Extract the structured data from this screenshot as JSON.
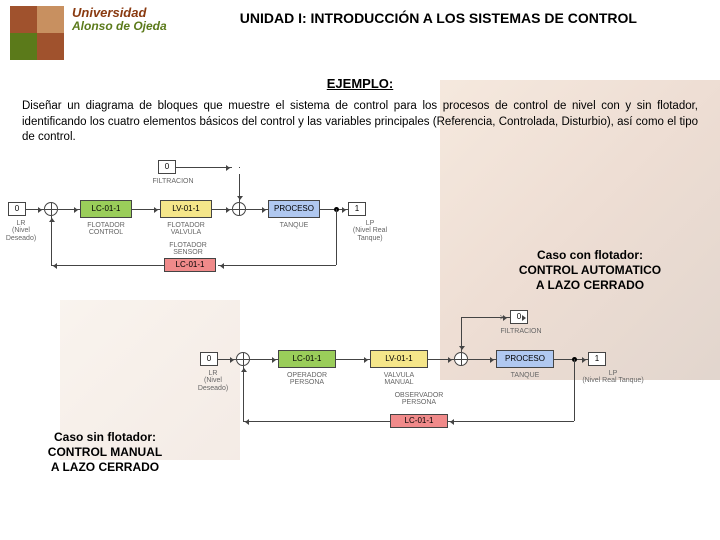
{
  "header": {
    "uni_line1": "Universidad",
    "uni_line2": "Alonso de Ojeda",
    "title": "UNIDAD I: INTRODUCCIÓN A LOS SISTEMAS DE CONTROL"
  },
  "subtitle": "EJEMPLO:",
  "body": "Diseñar un diagrama de bloques que muestre el sistema de control para los procesos de control de nivel con y sin flotador, identificando los cuatro elementos básicos del control y las variables principales (Referencia, Controlada, Disturbio), así como el tipo de control.",
  "diagram1": {
    "disturb_val": "0",
    "disturb_lbl": "FILTRACION",
    "input_box": "0",
    "input_lbl": "LR\n(Nivel\nDeseado)",
    "lc": "LC-01-1",
    "lc_lbl": "FLOTADOR\nCONTROL",
    "lv": "LV-01-1",
    "lv_lbl": "FLOTADOR\nVALVULA",
    "proc": "PROCESO",
    "proc_lbl": "TANQUE",
    "out_box": "1",
    "out_lbl": "LP\n(Nivel Real Tanque)",
    "sensor_lbl": "FLOTADOR\nSENSOR",
    "sensor": "LC-01-1",
    "caption": "Caso con flotador:\nCONTROL AUTOMATICO\nA LAZO CERRADO"
  },
  "diagram2": {
    "disturb_val": "0",
    "disturb_lbl": "FILTRACION",
    "input_box": "0",
    "input_lbl": "LR\n(Nivel\nDeseado)",
    "lc": "LC-01-1",
    "lc_lbl": "OPERADOR\nPERSONA",
    "lv": "LV-01-1",
    "lv_lbl": "VALVULA\nMANUAL",
    "proc": "PROCESO",
    "proc_lbl": "TANQUE",
    "out_box": "1",
    "out_lbl": "LP\n(Nivel Real Tanque)",
    "sensor_lbl": "OBSERVADOR\nPERSONA",
    "sensor": "LC-01-1",
    "caption": "Caso sin flotador:\nCONTROL MANUAL\nA LAZO CERRADO"
  }
}
